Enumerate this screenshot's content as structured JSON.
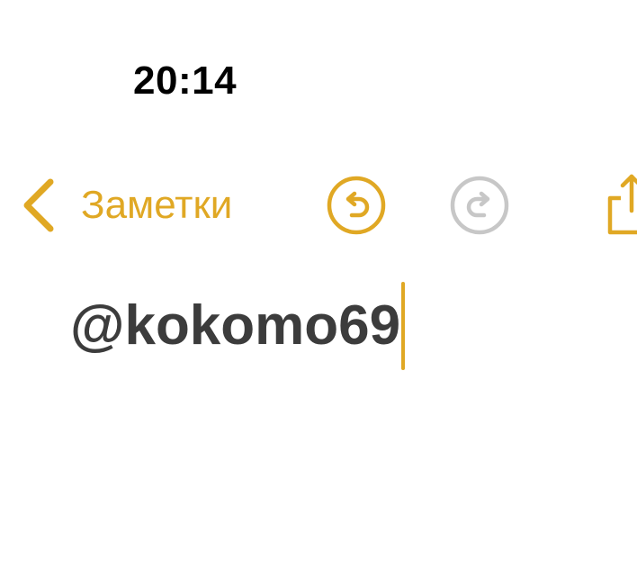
{
  "status_bar": {
    "time": "20:14"
  },
  "nav": {
    "back_label": "Заметки",
    "back_icon": "chevron-left-icon",
    "undo_icon": "undo-icon",
    "redo_icon": "redo-icon",
    "share_icon": "share-icon"
  },
  "note": {
    "text": "@kokomo69"
  },
  "colors": {
    "accent": "#E0A824",
    "disabled": "#C7C7C7",
    "text": "#3C3C3C",
    "background": "#FFFFFF"
  }
}
